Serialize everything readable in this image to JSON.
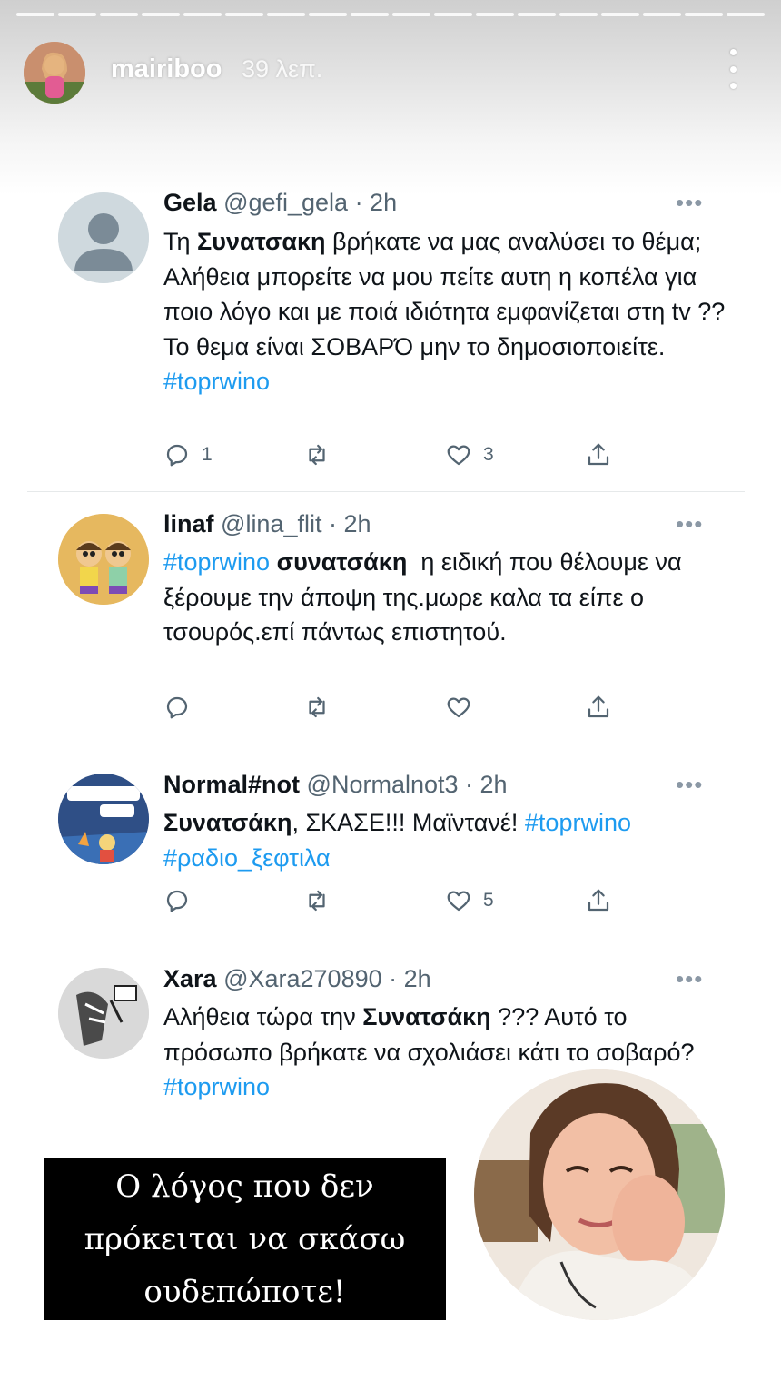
{
  "story": {
    "username": "mairiboo",
    "time": "39 λεπ."
  },
  "tweets": [
    {
      "name": "Gela",
      "handle": "@gefi_gela · 2h",
      "text_1": "Τη ",
      "bold_1": "Συνατσακη",
      "text_2": " βρήκατε να μας αναλύσει το θέμα; Αλήθεια μπορείτε να μου πείτε αυτη η κοπέλα για ποιο λόγο και με ποιά ιδιότητα εμφανίζεται στη tv ??Το θεμα είναι ΣΟΒΑΡΌ μην το δημοσιοποιείτε.",
      "tag_1": "#toprwino",
      "reply_count": "1",
      "retweet_count": "",
      "like_count": "3"
    },
    {
      "name": "linaf",
      "handle": "@lina_flit · 2h",
      "tag_1": "#toprwino",
      "bold_1": "συνατσάκη",
      "text_1": "  η ειδική που θέλουμε να ξέρουμε την άποψη της.μωρε καλα τα είπε ο τσουρός.επί πάντως επιστητού.",
      "reply_count": "",
      "retweet_count": "",
      "like_count": ""
    },
    {
      "name": "Normal#not",
      "handle": "@Normalnot3 · 2h",
      "bold_1": "Συνατσάκη",
      "text_1": ", ΣΚΑΣΕ!!! Μαϊντανέ! ",
      "tag_1": "#toprwino",
      "tag_2": "#ραδιο_ξεφτιλα",
      "reply_count": "",
      "retweet_count": "",
      "like_count": "5"
    },
    {
      "name": "Xara",
      "handle": "@Xara270890 · 2h",
      "text_1": "Αλήθεια τώρα την ",
      "bold_1": "Συνατσάκη",
      "text_2": " ??? Αυτό το πρόσωπο βρήκατε να σχολιάσει κάτι το σοβαρό?",
      "tag_1": "#toprwino"
    }
  ],
  "caption": {
    "line_1": "Ο λόγος που δεν",
    "line_2": "πρόκειται να σκάσω",
    "line_3": "ουδεπώποτε!"
  },
  "colors": {
    "link": "#1d9bf0",
    "muted": "#536471",
    "text": "#0f1419",
    "caption_bg": "#000000"
  },
  "icons": [
    "reply-icon",
    "retweet-icon",
    "like-icon",
    "share-icon",
    "more-icon"
  ]
}
